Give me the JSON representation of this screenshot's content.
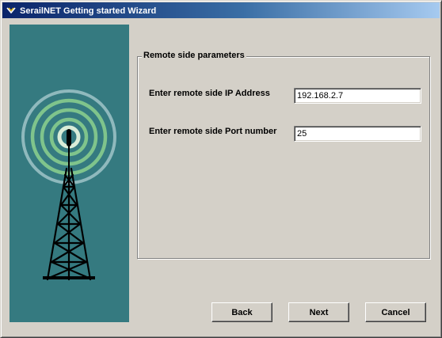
{
  "window": {
    "title": "SerailNET Getting started Wizard",
    "icon": "app-icon"
  },
  "banner": {
    "image": "radio-tower-icon",
    "colors": {
      "background": "#357a80",
      "outer_wave": "#8fb9bd",
      "middle_wave": "#7fc48c",
      "inner_wave": "#d9ecd8",
      "tower": "#000000"
    }
  },
  "group": {
    "legend": "Remote side parameters"
  },
  "fields": {
    "ip": {
      "label": "Enter remote side IP Address",
      "value": "192.168.2.7"
    },
    "port": {
      "label": "Enter remote side Port number",
      "value": "25"
    }
  },
  "buttons": {
    "back": "Back",
    "next": "Next",
    "cancel": "Cancel"
  }
}
